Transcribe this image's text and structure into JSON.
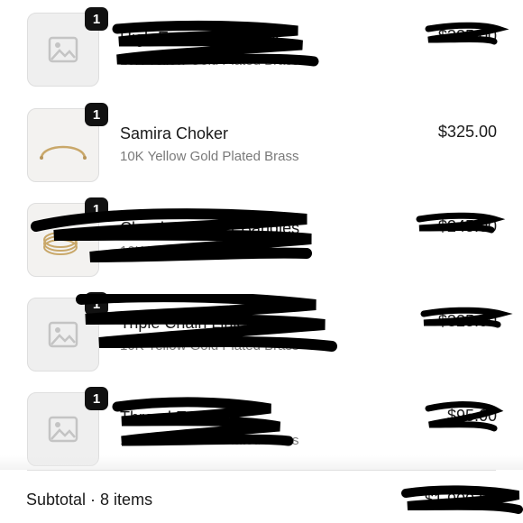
{
  "items": [
    {
      "qty": "1",
      "name": "High Essential Choker",
      "variant": "10K Yellow Gold Plated Brass",
      "price": "$325.00",
      "redacted": true
    },
    {
      "qty": "1",
      "name": "Samira Choker",
      "variant": "10K Yellow Gold Plated Brass",
      "price": "$325.00",
      "redacted": false
    },
    {
      "qty": "1",
      "name": "Classic Cylinder Bangles",
      "variant": "10K Yellow Gold Plated Brass",
      "price": "$245.00",
      "redacted": true
    },
    {
      "qty": "1",
      "name": "Triple Chain Link Ring",
      "variant": "10K Yellow Gold Plated Brass",
      "price": "$325.00",
      "redacted": true
    },
    {
      "qty": "1",
      "name": "Thread Ear Cuff",
      "variant": "10K Yellow Gold Plated Brass",
      "price": "$95.00",
      "redacted": true
    }
  ],
  "subtotal": {
    "label": "Subtotal · 8 items",
    "value": "$1,900.00"
  },
  "colors": {
    "badge": "#111111",
    "text": "#1a1a1a",
    "muted": "#7a7a7a",
    "thumb_bg": "#efefef"
  }
}
